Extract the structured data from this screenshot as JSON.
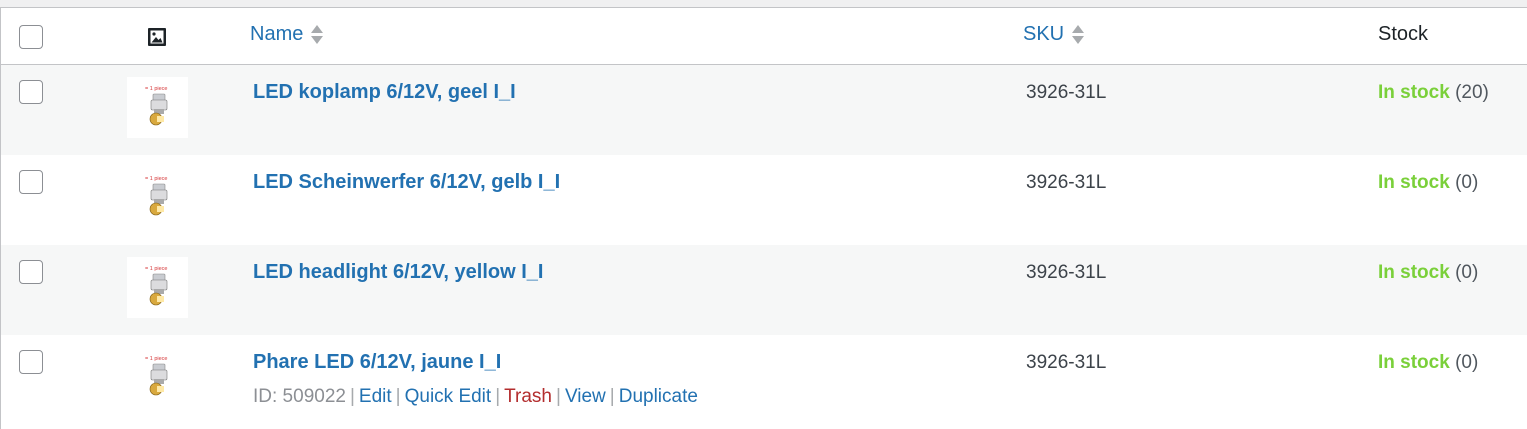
{
  "columns": {
    "name": "Name",
    "sku": "SKU",
    "stock": "Stock"
  },
  "icons": {
    "select_all": "checkbox",
    "image_column": "image-icon",
    "sort": "sort-arrows-icon",
    "thumbnail": "headlight-bulb-thumbnail"
  },
  "thumbnail_caption": "= 1 piece",
  "rows": [
    {
      "name": "LED koplamp 6/12V, geel I_I",
      "sku": "3926-31L",
      "stock_status": "In stock",
      "stock_qty": "(20)"
    },
    {
      "name": "LED Scheinwerfer 6/12V, gelb I_I",
      "sku": "3926-31L",
      "stock_status": "In stock",
      "stock_qty": "(0)"
    },
    {
      "name": "LED headlight 6/12V, yellow I_I",
      "sku": "3926-31L",
      "stock_status": "In stock",
      "stock_qty": "(0)"
    },
    {
      "name": "Phare LED 6/12V, jaune I_I",
      "sku": "3926-31L",
      "stock_status": "In stock",
      "stock_qty": "(0)"
    }
  ],
  "row_actions": {
    "id_label": "ID: 509022",
    "edit": "Edit",
    "quick_edit": "Quick Edit",
    "trash": "Trash",
    "view": "View",
    "duplicate": "Duplicate",
    "separator": "|"
  },
  "colors": {
    "link": "#2271b1",
    "in_stock": "#7ad03a",
    "trash": "#b32d2e",
    "alt_row": "#f6f7f7"
  }
}
